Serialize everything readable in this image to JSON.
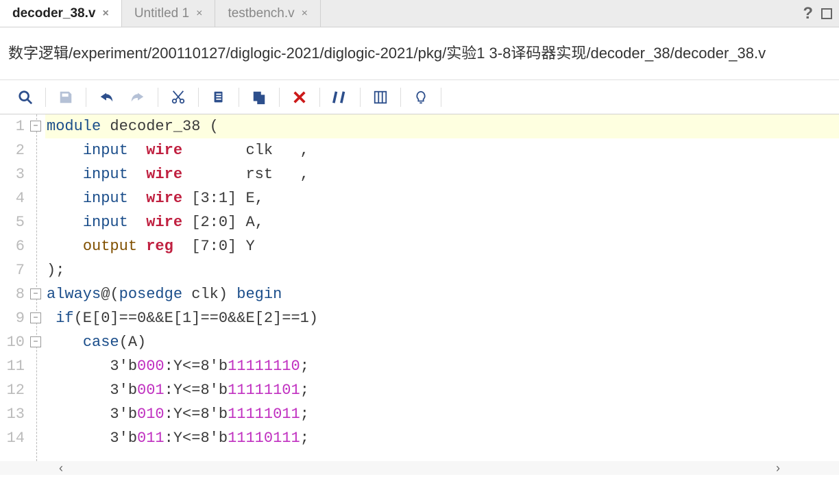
{
  "tabs": [
    {
      "label": "decoder_38.v",
      "active": true
    },
    {
      "label": "Untitled 1",
      "active": false
    },
    {
      "label": "testbench.v",
      "active": false
    }
  ],
  "help_glyph": "?",
  "path": "数字逻辑/experiment/200110127/diglogic-2021/diglogic-2021/pkg/实验1 3-8译码器实现/decoder_38/decoder_38.v",
  "toolbar": {
    "search": "search",
    "save": "save",
    "undo": "undo",
    "redo": "redo",
    "cut": "cut",
    "copy": "copy",
    "paste": "paste",
    "delete": "delete",
    "comment": "comment",
    "column": "column-select",
    "hint": "hint"
  },
  "fold_markers_at_lines": [
    1,
    8,
    9,
    10
  ],
  "code_lines": [
    {
      "n": 1,
      "hl": true,
      "tokens": [
        [
          "kw",
          "module"
        ],
        [
          "plain",
          " decoder_38 ("
        ]
      ]
    },
    {
      "n": 2,
      "hl": false,
      "tokens": [
        [
          "plain",
          "    "
        ],
        [
          "kw",
          "input"
        ],
        [
          "plain",
          "  "
        ],
        [
          "typ",
          "wire"
        ],
        [
          "plain",
          "       clk   ,"
        ]
      ]
    },
    {
      "n": 3,
      "hl": false,
      "tokens": [
        [
          "plain",
          "    "
        ],
        [
          "kw",
          "input"
        ],
        [
          "plain",
          "  "
        ],
        [
          "typ",
          "wire"
        ],
        [
          "plain",
          "       rst   ,"
        ]
      ]
    },
    {
      "n": 4,
      "hl": false,
      "tokens": [
        [
          "plain",
          "    "
        ],
        [
          "kw",
          "input"
        ],
        [
          "plain",
          "  "
        ],
        [
          "typ",
          "wire"
        ],
        [
          "plain",
          " [3:1] E,"
        ]
      ]
    },
    {
      "n": 5,
      "hl": false,
      "tokens": [
        [
          "plain",
          "    "
        ],
        [
          "kw",
          "input"
        ],
        [
          "plain",
          "  "
        ],
        [
          "typ",
          "wire"
        ],
        [
          "plain",
          " [2:0] A,"
        ]
      ]
    },
    {
      "n": 6,
      "hl": false,
      "tokens": [
        [
          "plain",
          "    "
        ],
        [
          "kw2",
          "output"
        ],
        [
          "plain",
          " "
        ],
        [
          "typ",
          "reg"
        ],
        [
          "plain",
          "  [7:0] Y"
        ]
      ]
    },
    {
      "n": 7,
      "hl": false,
      "tokens": [
        [
          "plain",
          ");"
        ]
      ]
    },
    {
      "n": 8,
      "hl": false,
      "tokens": [
        [
          "kw",
          "always"
        ],
        [
          "plain",
          "@("
        ],
        [
          "kw",
          "posedge"
        ],
        [
          "plain",
          " clk) "
        ],
        [
          "kw",
          "begin"
        ]
      ]
    },
    {
      "n": 9,
      "hl": false,
      "tokens": [
        [
          "plain",
          " "
        ],
        [
          "kw",
          "if"
        ],
        [
          "plain",
          "(E[0]==0&&E[1]==0&&E[2]==1)"
        ]
      ]
    },
    {
      "n": 10,
      "hl": false,
      "tokens": [
        [
          "plain",
          "    "
        ],
        [
          "kw",
          "case"
        ],
        [
          "plain",
          "(A)"
        ]
      ]
    },
    {
      "n": 11,
      "hl": false,
      "tokens": [
        [
          "plain",
          "       3'b"
        ],
        [
          "num",
          "000"
        ],
        [
          "plain",
          ":Y<=8'b"
        ],
        [
          "num",
          "11111110"
        ],
        [
          "plain",
          ";"
        ]
      ]
    },
    {
      "n": 12,
      "hl": false,
      "tokens": [
        [
          "plain",
          "       3'b"
        ],
        [
          "num",
          "001"
        ],
        [
          "plain",
          ":Y<=8'b"
        ],
        [
          "num",
          "11111101"
        ],
        [
          "plain",
          ";"
        ]
      ]
    },
    {
      "n": 13,
      "hl": false,
      "tokens": [
        [
          "plain",
          "       3'b"
        ],
        [
          "num",
          "010"
        ],
        [
          "plain",
          ":Y<=8'b"
        ],
        [
          "num",
          "11111011"
        ],
        [
          "plain",
          ";"
        ]
      ]
    },
    {
      "n": 14,
      "hl": false,
      "tokens": [
        [
          "plain",
          "       3'b"
        ],
        [
          "num",
          "011"
        ],
        [
          "plain",
          ":Y<=8'b"
        ],
        [
          "num",
          "11110111"
        ],
        [
          "plain",
          ";"
        ]
      ]
    }
  ],
  "scroll": {
    "left": "‹",
    "right": "›"
  }
}
